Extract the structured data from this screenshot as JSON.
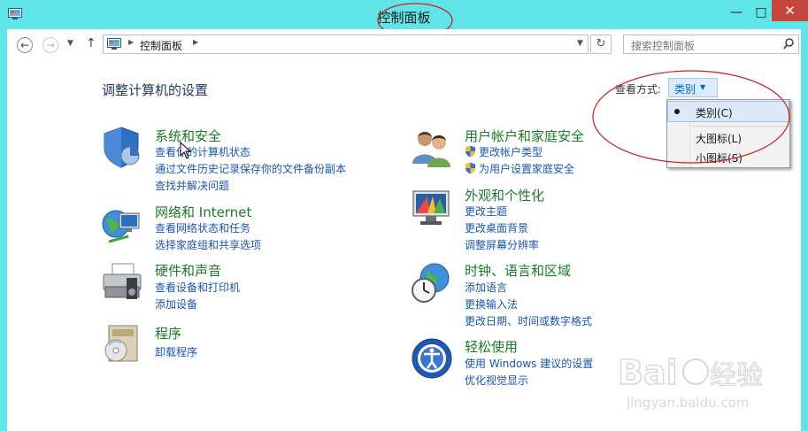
{
  "window": {
    "title": "控制面板",
    "controls": {
      "minimize": "—",
      "maximize": "□",
      "close": "✕"
    }
  },
  "navigation": {
    "back_icon": "back-arrow-icon",
    "forward_icon": "forward-arrow-icon",
    "up_icon": "up-arrow-icon",
    "address_crumbs": [
      "控制面板"
    ],
    "search_placeholder": "搜索控制面板"
  },
  "content": {
    "heading": "调整计算机的设置",
    "view_by": {
      "label": "查看方式:",
      "selected": "类别",
      "menu_options": [
        "类别(C)",
        "大图标(L)",
        "小图标(S)"
      ],
      "checked_option": "类别(C)"
    },
    "categories": [
      {
        "id": "system-security",
        "icon": "shield-icon",
        "title": "系统和安全",
        "links": [
          "查看你的计算机状态",
          "通过文件历史记录保存你的文件备份副本",
          "查找并解决问题"
        ]
      },
      {
        "id": "network",
        "icon": "network-globe-icon",
        "title": "网络和 Internet",
        "links": [
          "查看网络状态和任务",
          "选择家庭组和共享选项"
        ]
      },
      {
        "id": "hardware",
        "icon": "printer-icon",
        "title": "硬件和声音",
        "links": [
          "查看设备和打印机",
          "添加设备"
        ]
      },
      {
        "id": "programs",
        "icon": "programs-disc-icon",
        "title": "程序",
        "links": [
          "卸载程序"
        ]
      },
      {
        "id": "user-accounts",
        "icon": "users-icon",
        "title": "用户帐户和家庭安全",
        "links": [
          "更改帐户类型",
          "为用户设置家庭安全"
        ]
      },
      {
        "id": "appearance",
        "icon": "monitor-color-icon",
        "title": "外观和个性化",
        "links": [
          "更改主题",
          "更改桌面背景",
          "调整屏幕分辨率"
        ]
      },
      {
        "id": "clock-region",
        "icon": "clock-globe-icon",
        "title": "时钟、语言和区域",
        "links": [
          "添加语言",
          "更换输入法",
          "更改日期、时间或数字格式"
        ]
      },
      {
        "id": "ease-access",
        "icon": "ease-of-access-icon",
        "title": "轻松使用",
        "links": [
          "使用 Windows 建议的设置",
          "优化视觉显示"
        ]
      }
    ]
  },
  "annotations": {
    "color": "#cc1f1f"
  },
  "watermark": {
    "text": "Bai经验",
    "url": "jingyan.baidu.com"
  },
  "colors": {
    "titlebar": "#5fe4e8",
    "category_title": "#1b7a2a",
    "link": "#1a56b0",
    "heading": "#1e395b"
  }
}
